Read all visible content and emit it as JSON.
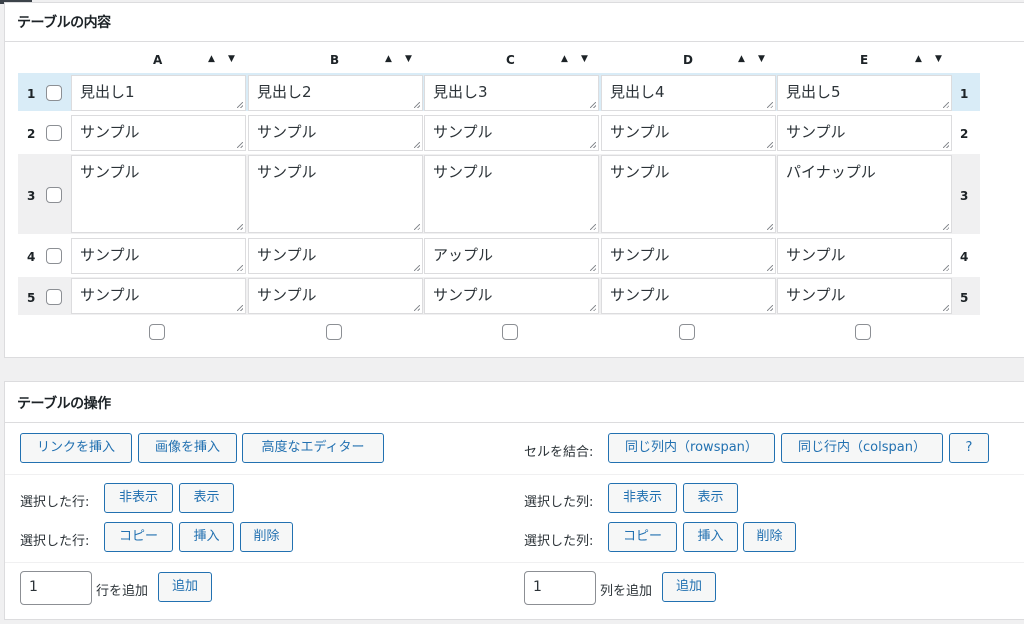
{
  "panel1": {
    "title": "テーブルの内容"
  },
  "columns": [
    "A",
    "B",
    "C",
    "D",
    "E"
  ],
  "sort_up": "▲",
  "sort_down": "▼",
  "rows": [
    {
      "num": "1",
      "cells": [
        "見出し1",
        "見出し2",
        "見出し3",
        "見出し4",
        "見出し5"
      ],
      "highlight": true
    },
    {
      "num": "2",
      "cells": [
        "サンプル",
        "サンプル",
        "サンプル",
        "サンプル",
        "サンプル"
      ]
    },
    {
      "num": "3",
      "cells": [
        "サンプル",
        "サンプル",
        "サンプル",
        "サンプル",
        "パイナップル"
      ]
    },
    {
      "num": "4",
      "cells": [
        "サンプル",
        "サンプル",
        "アップル",
        "サンプル",
        "サンプル"
      ]
    },
    {
      "num": "5",
      "cells": [
        "サンプル",
        "サンプル",
        "サンプル",
        "サンプル",
        "サンプル"
      ]
    }
  ],
  "panel2": {
    "title": "テーブルの操作",
    "insert_link": "リンクを挿入",
    "insert_image": "画像を挿入",
    "advanced_editor": "高度なエディター",
    "merge_label": "セルを結合:",
    "rowspan": "同じ列内（rowspan）",
    "colspan": "同じ行内（colspan）",
    "help": "?",
    "row_selected_label": "選択した行:",
    "col_selected_label": "選択した列:",
    "hide": "非表示",
    "show": "表示",
    "copy": "コピー",
    "insert": "挿入",
    "delete": "削除",
    "add_rows_value": "1",
    "add_rows_label": "行を追加",
    "add_cols_value": "1",
    "add_cols_label": "列を追加",
    "add": "追加"
  },
  "colors": {
    "accent": "#2271b1",
    "row_highlight": "#d9ecf7",
    "row_shade": "#f0f0f1"
  }
}
